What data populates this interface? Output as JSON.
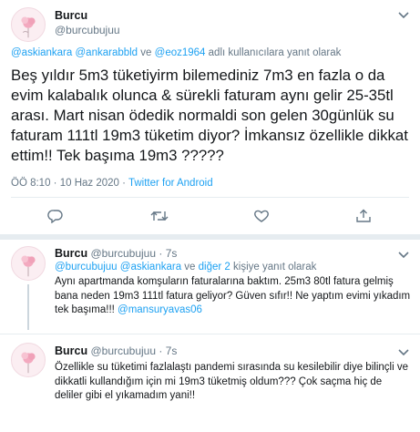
{
  "main_tweet": {
    "author_name": "Burcu",
    "author_handle": "@burcubujuu",
    "reply_prefix": "",
    "reply_user1": "@askiankara",
    "reply_user2": "@ankarabbld",
    "reply_and": " ve ",
    "reply_user3": "@eoz1964",
    "reply_suffix": " adlı kullanıcılara yanıt olarak",
    "text": "Beş yıldır 5m3 tüketiyirm bilemediniz 7m3 en fazla o da evim kalabalık olunca & sürekli faturam aynı gelir 25-35tl arası. Mart nisan ödedik normaldi son gelen 30günlük su faturam 111tl 19m3 tüketim diyor? İmkansız özellikle dikkat ettim!! Tek başıma 19m3 ?????",
    "time": "ÖÖ 8:10",
    "date_sep": " · ",
    "date": "10 Haz 2020",
    "source": "Twitter for Android"
  },
  "replies": [
    {
      "author_name": "Burcu",
      "author_handle": "@burcubujuu",
      "time": "7s",
      "reply_user1": "@burcubujuu",
      "reply_user2": "@askiankara",
      "reply_and": " ve ",
      "reply_others": "diğer 2",
      "reply_suffix": " kişiye yanıt olarak",
      "text_before": "Aynı apartmanda komşuların faturalarına baktım. 25m3 80tl fatura gelmiş bana neden 19m3 111tl fatura geliyor? Güven sıfır!! Ne yaptım evimi yıkadım tek başıma!!! ",
      "mention": "@mansuryavas06"
    },
    {
      "author_name": "Burcu",
      "author_handle": "@burcubujuu",
      "time": "7s",
      "text": "Özellikle su tüketimi fazlalaştı pandemi sırasında su kesilebilir diye bilinçli ve dikkatli kullandığım için mi 19m3 tüketmiş oldum??? Çok saçma hiç de deliler gibi el yıkamadım yani!!"
    }
  ],
  "colors": {
    "accent": "#1da1f2",
    "muted": "#657786",
    "text": "#14171a",
    "divider": "#e6ecf0"
  },
  "icons": [
    "avatar-rose-image",
    "chevron-down-icon",
    "reply-icon",
    "retweet-icon",
    "like-icon",
    "share-icon"
  ]
}
